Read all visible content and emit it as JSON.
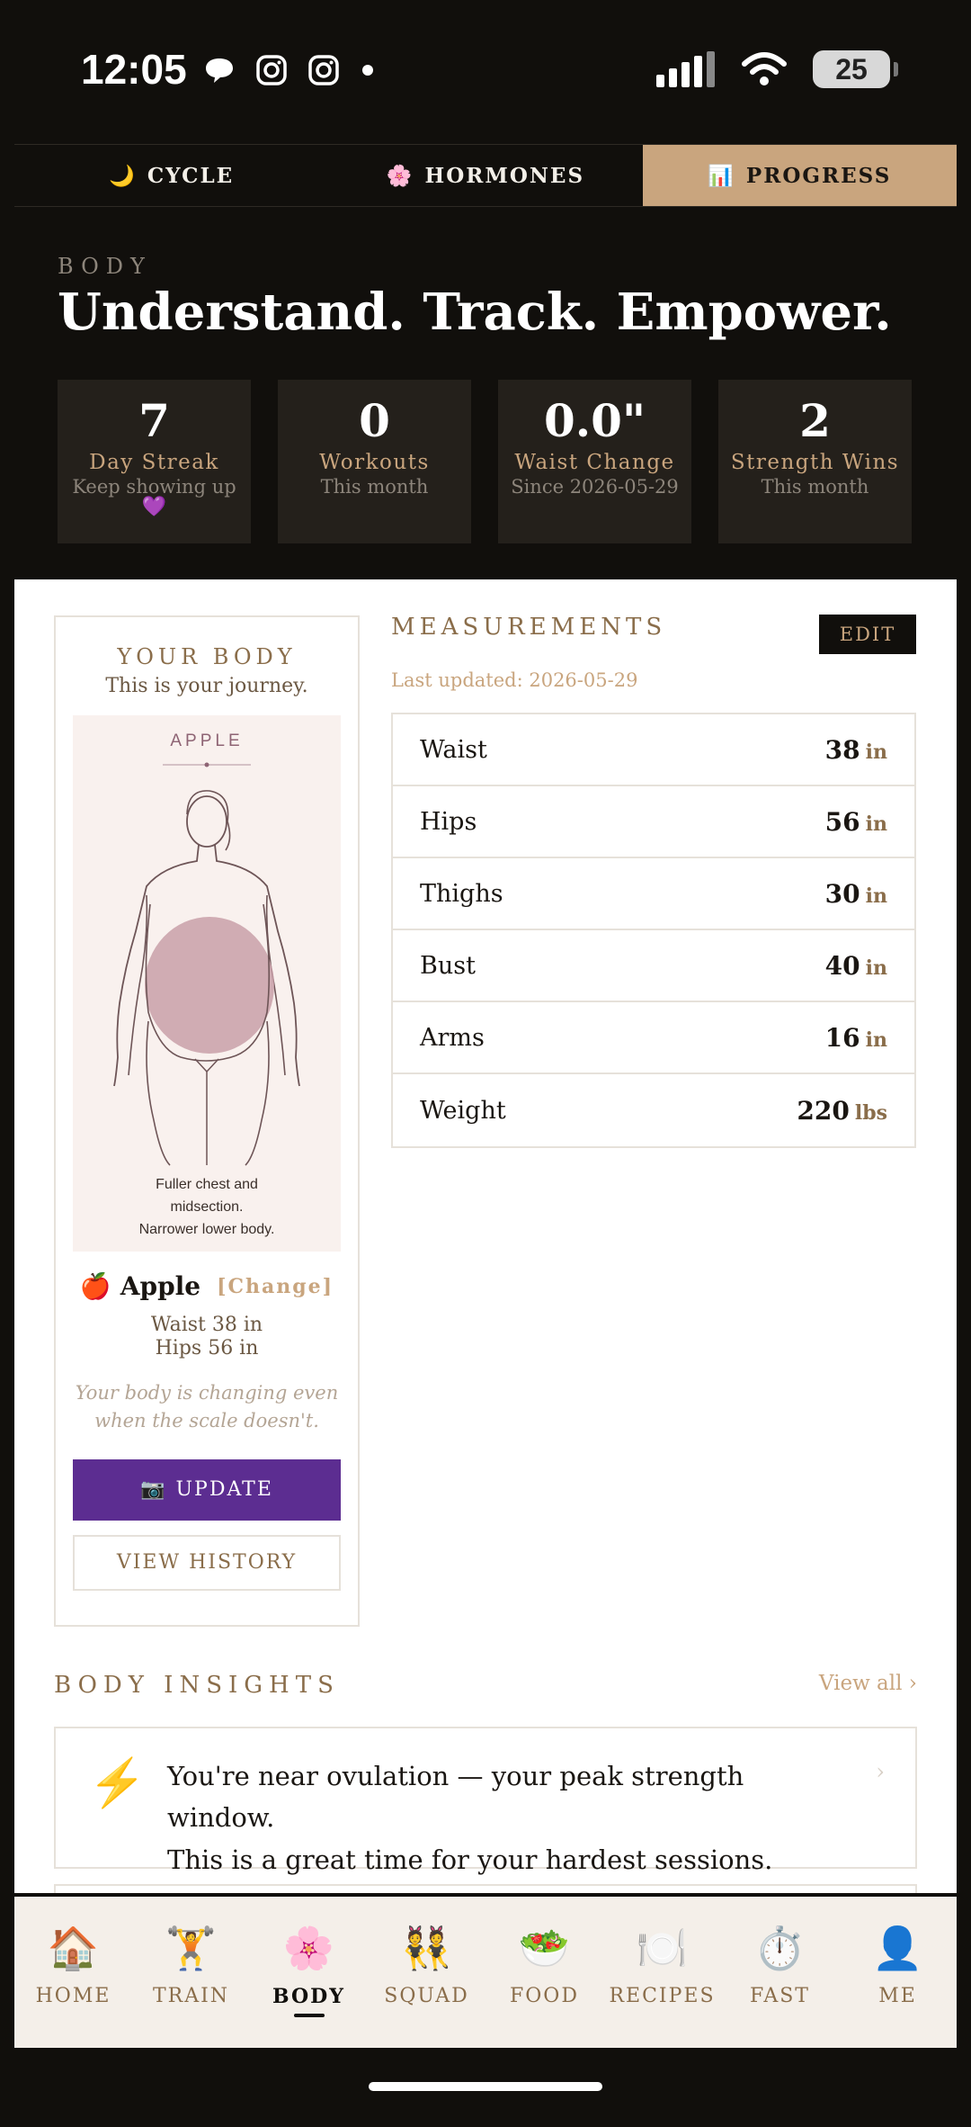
{
  "status_bar": {
    "time": "12:05",
    "battery": "25",
    "icons": [
      "message-bubble-icon",
      "instagram-icon",
      "instagram-icon",
      "dot-icon",
      "signal-icon",
      "wifi-icon",
      "battery-icon"
    ]
  },
  "top_tabs": [
    {
      "icon": "🌙",
      "label": "CYCLE",
      "active": false
    },
    {
      "icon": "🌸",
      "label": "HORMONES",
      "active": false
    },
    {
      "icon": "📊",
      "label": "PROGRESS",
      "active": true
    }
  ],
  "hero": {
    "eyebrow": "BODY",
    "title": "Understand. Track. Empower."
  },
  "stats": [
    {
      "value": "7",
      "label": "Day Streak",
      "sub": "Keep showing up",
      "extra": "💜"
    },
    {
      "value": "0",
      "label": "Workouts",
      "sub": "This month",
      "extra": ""
    },
    {
      "value": "0.0\"",
      "label": "Waist Change",
      "sub": "Since 2026-05-29",
      "extra": ""
    },
    {
      "value": "2",
      "label": "Strength Wins",
      "sub": "This month",
      "extra": ""
    }
  ],
  "body_card": {
    "title": "YOUR BODY",
    "subtitle": "This is your journey.",
    "shape_label": "APPLE",
    "shape_caption_1": "Fuller chest and",
    "shape_caption_2": "midsection.",
    "shape_caption_3": "Narrower lower body.",
    "shape_emoji": "🍎",
    "shape_name": "Apple",
    "change_label": "[Change]",
    "waist_line": "Waist 38 in",
    "hips_line": "Hips 56 in",
    "quote_1": "Your body is changing even",
    "quote_2": "when the scale doesn't.",
    "update_icon": "📷",
    "update_label": "UPDATE",
    "history_label": "VIEW HISTORY"
  },
  "measurements": {
    "title": "MEASUREMENTS",
    "edit_label": "EDIT",
    "updated": "Last updated: 2026-05-29",
    "rows": [
      {
        "name": "Waist",
        "value": "38",
        "unit": "in"
      },
      {
        "name": "Hips",
        "value": "56",
        "unit": "in"
      },
      {
        "name": "Thighs",
        "value": "30",
        "unit": "in"
      },
      {
        "name": "Bust",
        "value": "40",
        "unit": "in"
      },
      {
        "name": "Arms",
        "value": "16",
        "unit": "in"
      },
      {
        "name": "Weight",
        "value": "220",
        "unit": "lbs"
      }
    ]
  },
  "insights": {
    "title": "BODY INSIGHTS",
    "view_all": "View all ›",
    "card": {
      "icon": "⚡",
      "text_1": "You're near ovulation — your peak strength window.",
      "text_2": "This is a great time for your hardest sessions.",
      "chevron": "›"
    }
  },
  "bottom_nav": [
    {
      "icon": "🏠",
      "label": "HOME",
      "active": false
    },
    {
      "icon": "🏋️",
      "label": "TRAIN",
      "active": false
    },
    {
      "icon": "🌸",
      "label": "BODY",
      "active": true
    },
    {
      "icon": "👯",
      "label": "SQUAD",
      "active": false
    },
    {
      "icon": "🥗",
      "label": "FOOD",
      "active": false
    },
    {
      "icon": "🍽️",
      "label": "RECIPES",
      "active": false
    },
    {
      "icon": "⏱️",
      "label": "FAST",
      "active": false
    },
    {
      "icon": "👤",
      "label": "ME",
      "active": false
    }
  ],
  "colors": {
    "background_dark": "#110f0c",
    "accent_gold": "#c9a57e",
    "accent_brown": "#8a6d4a",
    "update_purple": "#5c2d91",
    "shape_fill": "#c9a0a8"
  }
}
